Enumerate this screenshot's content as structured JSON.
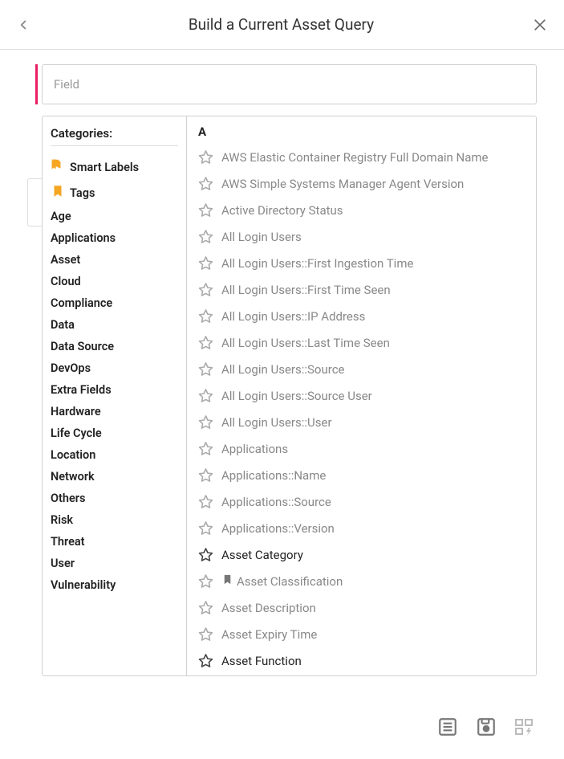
{
  "header": {
    "title": "Build a Current Asset Query"
  },
  "field_input": {
    "placeholder": "Field"
  },
  "categories": {
    "title": "Categories:",
    "smart_labels": "Smart Labels",
    "tags": "Tags",
    "items": [
      "Age",
      "Applications",
      "Asset",
      "Cloud",
      "Compliance",
      "Data",
      "Data Source",
      "DevOps",
      "Extra Fields",
      "Hardware",
      "Life Cycle",
      "Location",
      "Network",
      "Others",
      "Risk",
      "Threat",
      "User",
      "Vulnerability"
    ]
  },
  "fields": {
    "section": "A",
    "items": [
      {
        "label": "AWS Elastic Container Registry Full Domain Name",
        "highlight": false,
        "bookmark": false
      },
      {
        "label": "AWS Simple Systems Manager Agent Version",
        "highlight": false,
        "bookmark": false
      },
      {
        "label": "Active Directory Status",
        "highlight": false,
        "bookmark": false
      },
      {
        "label": "All Login Users",
        "highlight": false,
        "bookmark": false
      },
      {
        "label": "All Login Users::First Ingestion Time",
        "highlight": false,
        "bookmark": false
      },
      {
        "label": "All Login Users::First Time Seen",
        "highlight": false,
        "bookmark": false
      },
      {
        "label": "All Login Users::IP Address",
        "highlight": false,
        "bookmark": false
      },
      {
        "label": "All Login Users::Last Time Seen",
        "highlight": false,
        "bookmark": false
      },
      {
        "label": "All Login Users::Source",
        "highlight": false,
        "bookmark": false
      },
      {
        "label": "All Login Users::Source User",
        "highlight": false,
        "bookmark": false
      },
      {
        "label": "All Login Users::User",
        "highlight": false,
        "bookmark": false
      },
      {
        "label": "Applications",
        "highlight": false,
        "bookmark": false
      },
      {
        "label": "Applications::Name",
        "highlight": false,
        "bookmark": false
      },
      {
        "label": "Applications::Source",
        "highlight": false,
        "bookmark": false
      },
      {
        "label": "Applications::Version",
        "highlight": false,
        "bookmark": false
      },
      {
        "label": "Asset Category",
        "highlight": true,
        "bookmark": false
      },
      {
        "label": "Asset Classification",
        "highlight": false,
        "bookmark": true
      },
      {
        "label": "Asset Description",
        "highlight": false,
        "bookmark": false
      },
      {
        "label": "Asset Expiry Time",
        "highlight": false,
        "bookmark": false
      },
      {
        "label": "Asset Function",
        "highlight": true,
        "bookmark": false
      }
    ]
  }
}
